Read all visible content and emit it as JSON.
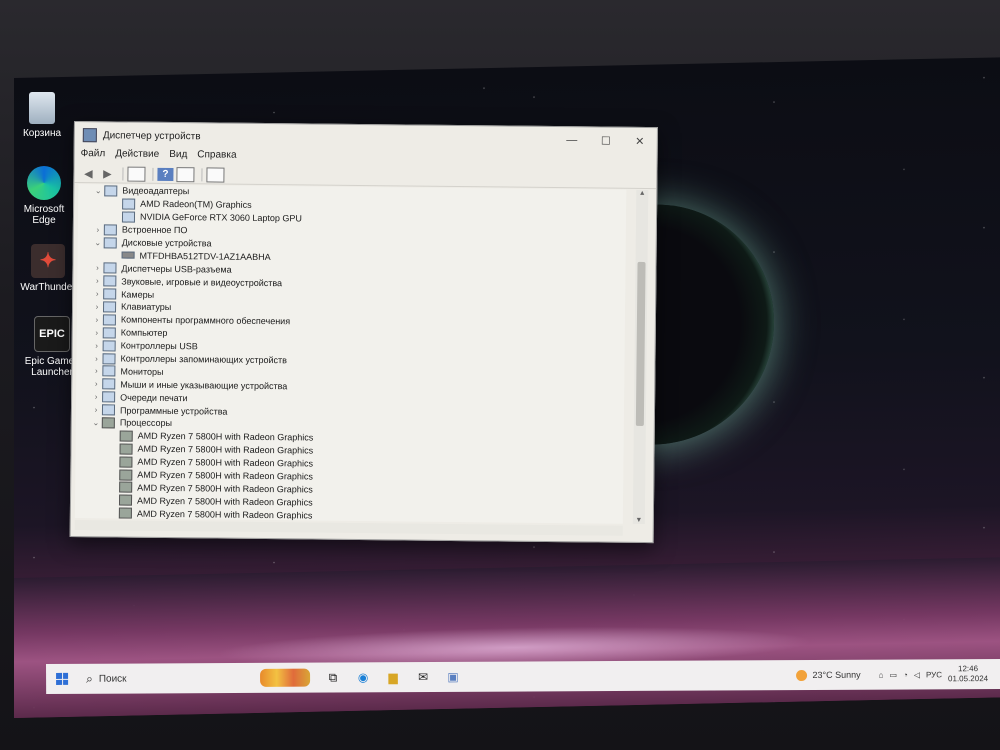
{
  "desktop": {
    "icons": [
      {
        "label": "Корзина"
      },
      {
        "label": "Microsoft Edge"
      },
      {
        "label": "WarThunder"
      },
      {
        "label": "Epic Games Launcher"
      }
    ]
  },
  "window": {
    "title": "Диспетчер устройств",
    "menu": [
      "Файл",
      "Действие",
      "Вид",
      "Справка"
    ],
    "caption_buttons": {
      "minimize": "—",
      "maximize": "☐",
      "close": "✕"
    },
    "tree": [
      {
        "label": "Видеоадаптеры",
        "level": 0,
        "expanded": true
      },
      {
        "label": "AMD Radeon(TM) Graphics",
        "level": 1
      },
      {
        "label": "NVIDIA GeForce RTX 3060 Laptop GPU",
        "level": 1
      },
      {
        "label": "Встроенное ПО",
        "level": 0,
        "expanded": false
      },
      {
        "label": "Дисковые устройства",
        "level": 0,
        "expanded": true
      },
      {
        "label": "MTFDHBA512TDV-1AZ1AABHA",
        "level": 1
      },
      {
        "label": "Диспетчеры USB-разъема",
        "level": 0,
        "expanded": false
      },
      {
        "label": "Звуковые, игровые и видеоустройства",
        "level": 0,
        "expanded": false
      },
      {
        "label": "Камеры",
        "level": 0,
        "expanded": false
      },
      {
        "label": "Клавиатуры",
        "level": 0,
        "expanded": false
      },
      {
        "label": "Компоненты программного обеспечения",
        "level": 0,
        "expanded": false
      },
      {
        "label": "Компьютер",
        "level": 0,
        "expanded": false
      },
      {
        "label": "Контроллеры USB",
        "level": 0,
        "expanded": false
      },
      {
        "label": "Контроллеры запоминающих устройств",
        "level": 0,
        "expanded": false
      },
      {
        "label": "Мониторы",
        "level": 0,
        "expanded": false
      },
      {
        "label": "Мыши и иные указывающие устройства",
        "level": 0,
        "expanded": false
      },
      {
        "label": "Очереди печати",
        "level": 0,
        "expanded": false
      },
      {
        "label": "Программные устройства",
        "level": 0,
        "expanded": false
      },
      {
        "label": "Процессоры",
        "level": 0,
        "expanded": true
      },
      {
        "label": "AMD Ryzen 7 5800H with Radeon Graphics",
        "level": 1
      },
      {
        "label": "AMD Ryzen 7 5800H with Radeon Graphics",
        "level": 1
      },
      {
        "label": "AMD Ryzen 7 5800H with Radeon Graphics",
        "level": 1
      },
      {
        "label": "AMD Ryzen 7 5800H with Radeon Graphics",
        "level": 1
      },
      {
        "label": "AMD Ryzen 7 5800H with Radeon Graphics",
        "level": 1
      },
      {
        "label": "AMD Ryzen 7 5800H with Radeon Graphics",
        "level": 1
      },
      {
        "label": "AMD Ryzen 7 5800H with Radeon Graphics",
        "level": 1
      }
    ]
  },
  "taskbar": {
    "search_label": "Поиск",
    "weather": "23°C  Sunny",
    "language": "РУС",
    "time": "12:46",
    "date": "01.05.2024"
  }
}
